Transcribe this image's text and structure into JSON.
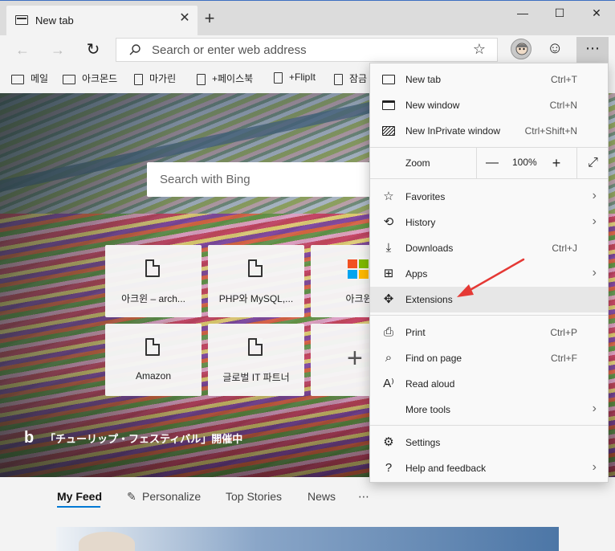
{
  "tab": {
    "title": "New tab",
    "close": "✕"
  },
  "newtab_button": "+",
  "window_controls": {
    "minimize": "—",
    "maximize": "☐",
    "close": "✕"
  },
  "nav": {
    "back": "←",
    "forward": "→",
    "refresh": "↻"
  },
  "address": {
    "placeholder": "Search or enter web address",
    "favorite": "☆"
  },
  "toolbar": {
    "feedback": "☺",
    "more": "⋯"
  },
  "favorites": [
    {
      "label": "메일",
      "icon": "folder-icon"
    },
    {
      "label": "아크몬드",
      "icon": "folder-icon"
    },
    {
      "label": "마가린",
      "icon": "page-icon"
    },
    {
      "label": "+페이스북",
      "icon": "page-icon"
    },
    {
      "label": "+FlipIt",
      "icon": "page-icon"
    },
    {
      "label": "잠금",
      "icon": "page-icon"
    }
  ],
  "hero": {
    "search_placeholder": "Search with Bing",
    "caption": "「チューリップ・フェスティバル」開催中",
    "bing_logo": "b"
  },
  "tiles": [
    {
      "label": "아크윈 – arch...",
      "icon": "page-icon"
    },
    {
      "label": "PHP와 MySQL,...",
      "icon": "page-icon"
    },
    {
      "label": "아크윈",
      "icon": "windows-logo-icon"
    },
    {
      "label": "Amazon",
      "icon": "page-icon"
    },
    {
      "label": "글로벌 IT 파트너",
      "icon": "page-icon"
    },
    {
      "label": "+",
      "icon": "add-icon"
    }
  ],
  "feed": {
    "tabs": [
      "My Feed",
      "Personalize",
      "Top Stories",
      "News",
      "⋯"
    ],
    "active": "My Feed",
    "personalize_icon": "✎"
  },
  "menu": {
    "new_tab": {
      "label": "New tab",
      "shortcut": "Ctrl+T"
    },
    "new_window": {
      "label": "New window",
      "shortcut": "Ctrl+N"
    },
    "new_inprivate": {
      "label": "New InPrivate window",
      "shortcut": "Ctrl+Shift+N"
    },
    "zoom": {
      "label": "Zoom",
      "value": "100%",
      "minus": "—",
      "plus": "+",
      "fullscreen": "⤢"
    },
    "favorites": {
      "label": "Favorites",
      "chevron": "›"
    },
    "history": {
      "label": "History",
      "chevron": "›"
    },
    "downloads": {
      "label": "Downloads",
      "shortcut": "Ctrl+J"
    },
    "apps": {
      "label": "Apps",
      "chevron": "›"
    },
    "extensions": {
      "label": "Extensions"
    },
    "print": {
      "label": "Print",
      "shortcut": "Ctrl+P"
    },
    "find": {
      "label": "Find on page",
      "shortcut": "Ctrl+F"
    },
    "read_aloud": {
      "label": "Read aloud"
    },
    "more_tools": {
      "label": "More tools",
      "chevron": "›"
    },
    "settings": {
      "label": "Settings"
    },
    "help": {
      "label": "Help and feedback",
      "chevron": "›"
    }
  },
  "colors": {
    "accent": "#0078d4",
    "annotation_arrow": "#e53935"
  }
}
